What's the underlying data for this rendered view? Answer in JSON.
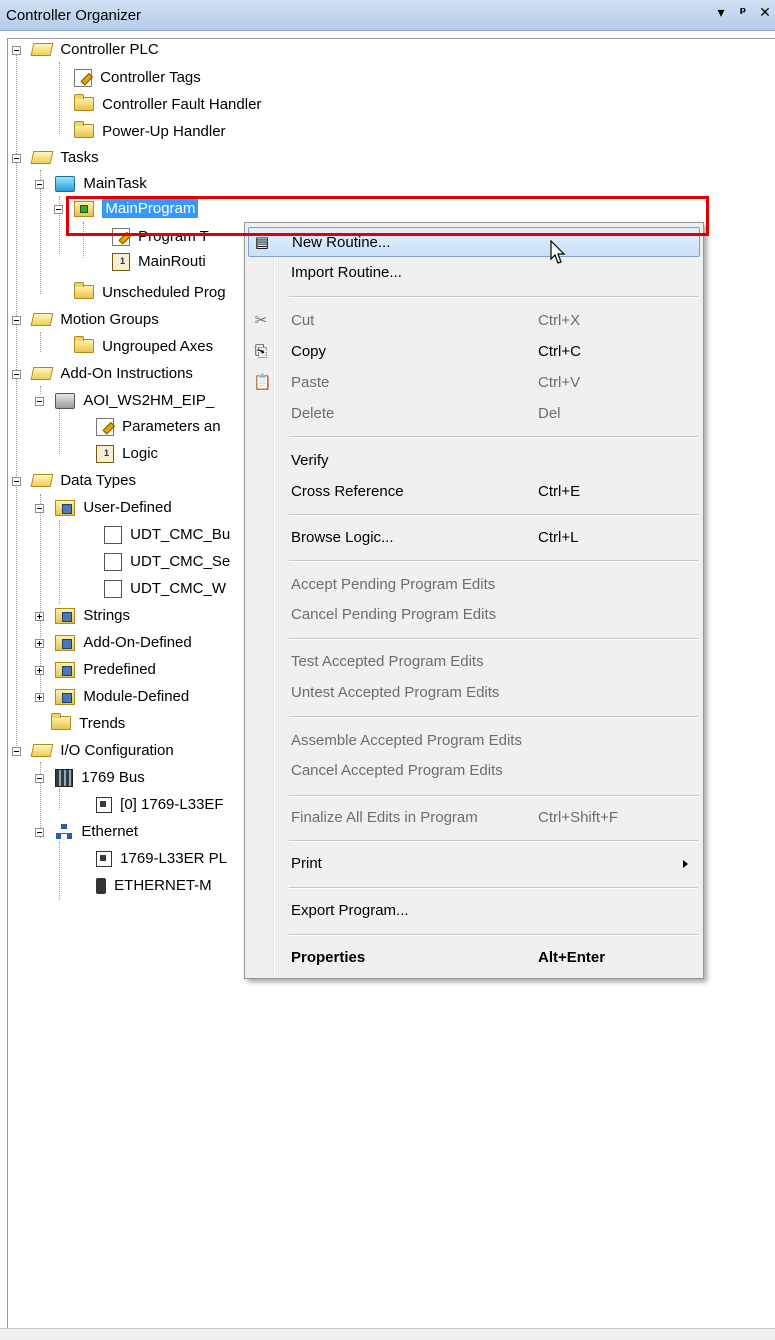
{
  "window": {
    "title": "Controller Organizer",
    "buttons": {
      "dropdown": "▾",
      "pin": "ᵖ",
      "close": "✕"
    }
  },
  "tree": {
    "controller": "Controller PLC",
    "controller_tags": "Controller Tags",
    "fault_handler": "Controller Fault Handler",
    "powerup_handler": "Power-Up Handler",
    "tasks": "Tasks",
    "main_task": "MainTask",
    "main_program": "MainProgram",
    "program_tags": "Program T",
    "main_routine": "MainRouti",
    "unscheduled": "Unscheduled Prog",
    "motion_groups": "Motion Groups",
    "ungrouped_axes": "Ungrouped Axes",
    "addon_instructions": "Add-On Instructions",
    "aoi_name": "AOI_WS2HM_EIP_",
    "aoi_params": "Parameters an",
    "aoi_logic": "Logic",
    "data_types": "Data Types",
    "user_defined": "User-Defined",
    "udt1": "UDT_CMC_Bu",
    "udt2": "UDT_CMC_Se",
    "udt3": "UDT_CMC_W",
    "strings": "Strings",
    "addon_defined": "Add-On-Defined",
    "predefined": "Predefined",
    "module_defined": "Module-Defined",
    "trends": "Trends",
    "io_config": "I/O Configuration",
    "bus": "1769 Bus",
    "bus_module": "[0] 1769-L33EF",
    "ethernet": "Ethernet",
    "eth_module1": "1769-L33ER PL",
    "eth_module2": "ETHERNET-M"
  },
  "context_menu": {
    "new_routine": "New Routine...",
    "import_routine": "Import Routine...",
    "cut": "Cut",
    "cut_key": "Ctrl+X",
    "copy": "Copy",
    "copy_key": "Ctrl+C",
    "paste": "Paste",
    "paste_key": "Ctrl+V",
    "delete": "Delete",
    "delete_key": "Del",
    "verify": "Verify",
    "cross_reference": "Cross Reference",
    "cross_reference_key": "Ctrl+E",
    "browse_logic": "Browse Logic...",
    "browse_logic_key": "Ctrl+L",
    "accept_pending": "Accept Pending Program Edits",
    "cancel_pending": "Cancel Pending Program Edits",
    "test_accepted": "Test Accepted Program Edits",
    "untest_accepted": "Untest Accepted Program Edits",
    "assemble_accepted": "Assemble Accepted Program Edits",
    "cancel_accepted": "Cancel Accepted Program Edits",
    "finalize_all": "Finalize All Edits in Program",
    "finalize_all_key": "Ctrl+Shift+F",
    "print": "Print",
    "export_program": "Export Program...",
    "properties": "Properties",
    "properties_key": "Alt+Enter"
  },
  "colors": {
    "selection": "#3399ff",
    "highlight_box": "#e00000",
    "menu_bg": "#f0f0f0"
  }
}
